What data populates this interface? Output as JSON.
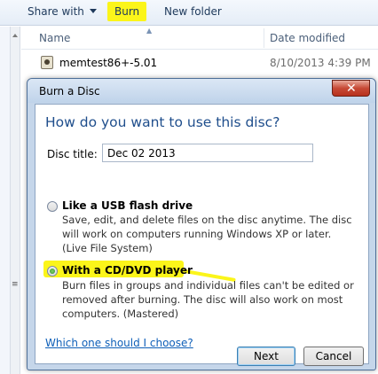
{
  "explorer": {
    "toolbar": {
      "share_with": "Share with",
      "burn": "Burn",
      "new_folder": "New folder"
    },
    "columns": {
      "name": "Name",
      "date_modified": "Date modified"
    },
    "files": [
      {
        "name": "memtest86+-5.01",
        "date_modified": "8/10/2013 4:39 PM"
      }
    ]
  },
  "dialog": {
    "title": "Burn a Disc",
    "close_glyph": "✕",
    "heading": "How do you want to use this disc?",
    "disc_title_label": "Disc title:",
    "disc_title_value": "Dec 02 2013",
    "options": [
      {
        "title": "Like a USB flash drive",
        "description": "Save, edit, and delete files on the disc anytime. The disc will work on computers running Windows XP or later. (Live File System)",
        "selected": false
      },
      {
        "title": "With a CD/DVD player",
        "description": "Burn files in groups and individual files can't be edited or removed after burning. The disc will also work on most computers. (Mastered)",
        "selected": true
      }
    ],
    "help_link": "Which one should I choose?",
    "buttons": {
      "next": "Next",
      "cancel": "Cancel"
    }
  },
  "colors": {
    "highlight": "#fbf51a",
    "heading_blue": "#1f4e8c",
    "link_blue": "#0e5fb8",
    "close_red": "#c74a36"
  }
}
